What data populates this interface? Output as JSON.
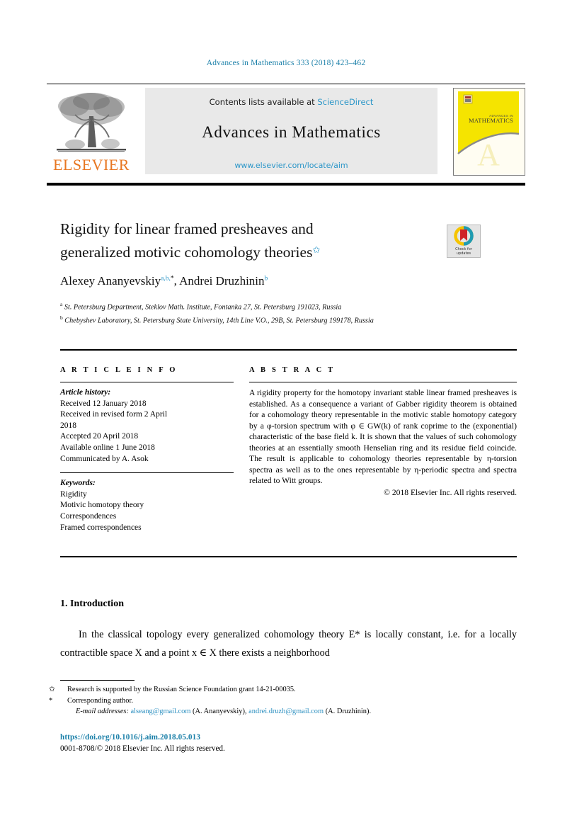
{
  "running_head": "Advances in Mathematics 333 (2018) 423–462",
  "masthead": {
    "contents_prefix": "Contents lists available at ",
    "sciencedirect": "ScienceDirect",
    "journal_title": "Advances in Mathematics",
    "journal_url": "www.elsevier.com/locate/aim",
    "publisher": "ELSEVIER",
    "cover_title_small": "ADVANCES IN",
    "cover_title_main": "MATHEMATICS",
    "accent_blue": "#2b96c8",
    "elsevier_orange": "#e87722",
    "cover_yellow": "#f5e400"
  },
  "article": {
    "title_line1": "Rigidity for linear framed presheaves and",
    "title_line2": "generalized motivic cohomology theories",
    "title_footnote_mark": "✩",
    "crossmark_line1": "Check for",
    "crossmark_line2": "updates",
    "authors_a": "Alexey Ananyevskiy",
    "authors_a_sup": "a,b,",
    "authors_a_ast": "*",
    "authors_sep": ", ",
    "authors_b": "Andrei Druzhinin",
    "authors_b_sup": "b",
    "affiliations": [
      {
        "mark": "a",
        "text": "St. Petersburg Department, Steklov Math. Institute, Fontanka 27, St. Petersburg 191023, Russia"
      },
      {
        "mark": "b",
        "text": "Chebyshev Laboratory, St. Petersburg State University, 14th Line V.O., 29B, St. Petersburg 199178, Russia"
      }
    ]
  },
  "article_info": {
    "heading": "A R T I C L E   I N F O",
    "history_label": "Article history:",
    "history": [
      "Received 12 January 2018",
      "Received in revised form 2 April",
      "2018",
      "Accepted 20 April 2018",
      "Available online 1 June 2018",
      "Communicated by A. Asok"
    ],
    "keywords_label": "Keywords:",
    "keywords": [
      "Rigidity",
      "Motivic homotopy theory",
      "Correspondences",
      "Framed correspondences"
    ]
  },
  "abstract": {
    "heading": "A B S T R A C T",
    "body": "A rigidity property for the homotopy invariant stable linear framed presheaves is established. As a consequence a variant of Gabber rigidity theorem is obtained for a cohomology theory representable in the motivic stable homotopy category by a φ-torsion spectrum with φ ∈ GW(k) of rank coprime to the (exponential) characteristic of the base field k. It is shown that the values of such cohomology theories at an essentially smooth Henselian ring and its residue field coincide. The result is applicable to cohomology theories representable by η-torsion spectra as well as to the ones representable by η-periodic spectra and spectra related to Witt groups.",
    "copyright": "© 2018 Elsevier Inc. All rights reserved."
  },
  "introduction": {
    "heading": "1. Introduction",
    "paragraph": "In the classical topology every generalized cohomology theory E* is locally constant, i.e. for a locally contractible space X and a point x ∈ X there exists a neighborhood"
  },
  "footnotes": {
    "star_mark": "✩",
    "star_text": "Research is supported by the Russian Science Foundation grant 14-21-00035.",
    "corresponding_mark": "*",
    "corresponding_text": "Corresponding author.",
    "email_label": "E-mail addresses:",
    "email_1": "alseang@gmail.com",
    "email_1_name": "(A. Ananyevskiy),",
    "email_2": "andrei.druzh@gmail.com",
    "email_2_name": "(A. Druzhinin)."
  },
  "imprint": {
    "doi": "https://doi.org/10.1016/j.aim.2018.05.013",
    "issn_line": "0001-8708/© 2018 Elsevier Inc. All rights reserved."
  }
}
